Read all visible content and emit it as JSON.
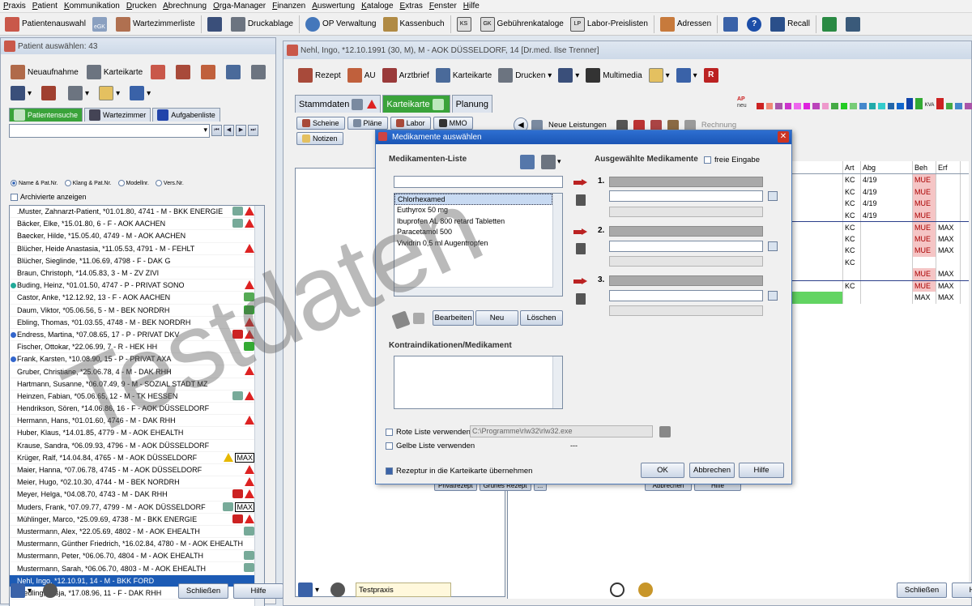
{
  "menu": [
    "Praxis",
    "Patient",
    "Kommunikation",
    "Drucken",
    "Abrechnung",
    "Orga-Manager",
    "Finanzen",
    "Auswertung",
    "Kataloge",
    "Extras",
    "Fenster",
    "Hilfe"
  ],
  "toolbar": {
    "patientenauswahl": "Patientenauswahl",
    "egk": "eGK",
    "wartezimmerliste": "Wartezimmerliste",
    "druckablage": "Druckablage",
    "op_verwaltung": "OP Verwaltung",
    "kassenbuch": "Kassenbuch",
    "ks": "KS",
    "gk": "GK",
    "gebuehrenkataloge": "Gebührenkataloge",
    "lp": "LP",
    "laborpreislisten": "Labor-Preislisten",
    "adressen": "Adressen",
    "recall": "Recall"
  },
  "left_window": {
    "title": "Patient auswählen: 43",
    "neuaufnahme": "Neuaufnahme",
    "karteikarte": "Karteikarte",
    "tabs": [
      "Patientensuche",
      "Wartezimmer",
      "Aufgabenliste"
    ],
    "radios": [
      "Name & Pat.Nr.",
      "Klang & Pat.Nr.",
      "Modellnr.",
      "Vers.Nr."
    ],
    "archiv": "Archivierte anzeigen",
    "patients": [
      {
        "text": ".Muster, Zahnarzt-Patient, *01.01.80, 4741 - M - BKK ENERGIE",
        "warn": "red",
        "mico": "#7a9",
        "max": ""
      },
      {
        "text": "Bäcker, Elke, *15.01.80, 6 - F - AOK AACHEN",
        "warn": "red",
        "mico": "#7a9",
        "max": ""
      },
      {
        "text": "Baecker, Hilde, *15.05.40, 4749 - M - AOK AACHEN",
        "warn": "",
        "mico": "",
        "max": ""
      },
      {
        "text": "Blücher, Heide Anastasia, *11.05.53, 4791 - M - FEHLT",
        "warn": "red",
        "mico": "",
        "max": ""
      },
      {
        "text": "Blücher, Sieglinde, *11.06.69, 4798 - F - DAK G",
        "warn": "",
        "mico": "",
        "max": ""
      },
      {
        "text": "Braun, Christoph, *14.05.83, 3 - M - ZV ZIVI",
        "warn": "",
        "mico": "",
        "max": ""
      },
      {
        "text": "Buding, Heinz, *01.01.50, 4747 - P - PRIVAT SONO",
        "warn": "red",
        "mico": "",
        "max": "",
        "dot": "#2a9"
      },
      {
        "text": "Castor, Anke, *12.12.92, 13 - F - AOK AACHEN",
        "warn": "",
        "mico": "#5a5",
        "max": ""
      },
      {
        "text": "Daum, Viktor, *05.06.56, 5 - M - BEK NORDRH",
        "warn": "",
        "mico": "#3a3",
        "max": ""
      },
      {
        "text": "Ebling, Thomas, *01.03.55, 4748 - M - BEK NORDRH",
        "warn": "red",
        "mico": "",
        "max": ""
      },
      {
        "text": "Endress, Martina, *07.08.65, 17 - P - PRIVAT DKV",
        "warn": "red",
        "mico": "#c22",
        "max": "",
        "dot": "#36c"
      },
      {
        "text": "Fischer, Ottokar, *22.06.99, 7 - R - HEK HH",
        "warn": "",
        "mico": "#3a3",
        "max": ""
      },
      {
        "text": "Frank, Karsten, *10.08.90, 15 - P - PRIVAT AXA",
        "warn": "",
        "mico": "",
        "max": "",
        "dot": "#36c"
      },
      {
        "text": "Gruber, Christiane, *25.06.78, 4 - M - DAK RHH",
        "warn": "red",
        "mico": "",
        "max": ""
      },
      {
        "text": "Hartmann, Susanne, *06.07.49, 9 - M - SOZIAL STADT MZ",
        "warn": "",
        "mico": "",
        "max": ""
      },
      {
        "text": "Heinzen, Fabian, *05.06.65, 12 - M - TK HESSEN",
        "warn": "red",
        "mico": "#7a9",
        "max": ""
      },
      {
        "text": "Hendrikson, Sören, *14.06.86, 16 - F - AOK DÜSSELDORF",
        "warn": "",
        "mico": "",
        "max": ""
      },
      {
        "text": "Hermann, Hans, *01.01.60, 4746 - M - DAK RHH",
        "warn": "red",
        "mico": "",
        "max": ""
      },
      {
        "text": "Huber, Klaus, *14.01.85, 4779 - M - AOK EHEALTH",
        "warn": "",
        "mico": "",
        "max": ""
      },
      {
        "text": "Krause, Sandra, *06.09.93, 4796 - M - AOK DÜSSELDORF",
        "warn": "",
        "mico": "",
        "max": ""
      },
      {
        "text": "Krüger, Ralf, *14.04.84, 4765 - M - AOK DÜSSELDORF",
        "warn": "yellow",
        "mico": "",
        "max": "MAX"
      },
      {
        "text": "Maier, Hanna, *07.06.78, 4745 - M - AOK DÜSSELDORF",
        "warn": "red",
        "mico": "",
        "max": ""
      },
      {
        "text": "Meier, Hugo, *02.10.30, 4744 - M - BEK NORDRH",
        "warn": "red",
        "mico": "",
        "max": ""
      },
      {
        "text": "Meyer, Helga, *04.08.70, 4743 - M - DAK RHH",
        "warn": "red",
        "mico": "#c22",
        "max": ""
      },
      {
        "text": "Muders, Frank, *07.09.77, 4799 - M - AOK DÜSSELDORF",
        "warn": "",
        "mico": "#7a9",
        "max": "MAX"
      },
      {
        "text": "Mühlinger, Marco, *25.09.69, 4738 - M - BKK ENERGIE",
        "warn": "red",
        "mico": "#c22",
        "max": ""
      },
      {
        "text": "Mustermann, Alex, *22.05.69, 4802 - M - AOK EHEALTH",
        "warn": "",
        "mico": "#7a9",
        "max": ""
      },
      {
        "text": "Mustermann, Günther Friedrich, *16.02.84, 4780 - M - AOK EHEALTH",
        "warn": "",
        "mico": "",
        "max": ""
      },
      {
        "text": "Mustermann, Peter, *06.06.70, 4804 - M - AOK EHEALTH",
        "warn": "",
        "mico": "#7a9",
        "max": ""
      },
      {
        "text": "Mustermann, Sarah, *06.06.70, 4803 - M - AOK EHEALTH",
        "warn": "",
        "mico": "#7a9",
        "max": ""
      },
      {
        "text": "Nehl, Ingo, *12.10.91, 14 - M - BKK FORD",
        "warn": "",
        "mico": "",
        "max": "",
        "sel": true
      },
      {
        "text": "Riedling, Tasja, *17.08.96, 11 - F - DAK RHH",
        "warn": "",
        "mico": "",
        "max": "",
        "dot": "#3a3"
      }
    ],
    "schliessen": "Schließen",
    "hilfe": "Hilfe"
  },
  "right_window": {
    "title": "Nehl, Ingo, *12.10.1991 (30, M), M - AOK DÜSSELDORF, 14 [Dr.med. Ilse Trenner]",
    "tools": [
      "Rezept",
      "AU",
      "Arztbrief",
      "Karteikarte",
      "Drucken",
      "Multimedia"
    ],
    "tabs": [
      "Stammdaten",
      "Karteikarte",
      "Planung"
    ],
    "subtabs": [
      "Scheine",
      "Pläne",
      "Labor",
      "MMO",
      "Notizen"
    ],
    "neue_leistungen": "Neue Leistungen",
    "rechnung": "Rechnung",
    "ap": "AP",
    "neu": "neu",
    "kva": "KVA",
    "columns": [
      "Art",
      "Abg",
      "Beh",
      "Erf"
    ],
    "rows": [
      {
        "art": "KC",
        "abg": "4/19",
        "beh": "MUE",
        "erf": ""
      },
      {
        "art": "KC",
        "abg": "4/19",
        "beh": "MUE",
        "erf": ""
      },
      {
        "art": "KC",
        "abg": "4/19",
        "beh": "MUE",
        "erf": ""
      },
      {
        "art": "KC",
        "abg": "4/19",
        "beh": "MUE",
        "erf": ""
      },
      {
        "art": "KC",
        "abg": "",
        "beh": "MUE",
        "erf": "MAX"
      },
      {
        "art": "KC",
        "abg": "",
        "beh": "MUE",
        "erf": "MAX"
      },
      {
        "art": "KC",
        "abg": "",
        "beh": "MUE",
        "erf": "MAX"
      },
      {
        "art": "KC",
        "abg": "",
        "beh": "",
        "erf": ""
      },
      {
        "art": "",
        "abg": "",
        "beh": "MUE",
        "erf": "MAX"
      },
      {
        "art": "KC",
        "abg": "",
        "beh": "MUE",
        "erf": "MAX"
      },
      {
        "art": "",
        "abg": "",
        "beh": "MAX",
        "erf": "MAX"
      }
    ],
    "praxis": "Testpraxis",
    "bg_buttons": [
      "Privatrezept",
      "Grünes Rezept",
      "..."
    ],
    "bg_buttons2": [
      "Abbrechen",
      "Hilfe"
    ],
    "schliessen": "Schließen",
    "hilfe": "Hilfe"
  },
  "dialog": {
    "title": "Medikamente auswählen",
    "list_label": "Medikamenten-Liste",
    "selected_label": "Ausgewählte Medikamente",
    "freie_eingabe": "freie Eingabe",
    "medications": [
      "Chlorhexamed",
      "Euthyrox 50 mg",
      "Ibuprofen AL 800 retard Tabletten",
      "Paracetamol 500",
      "Vividrin 0,5 ml Augentropfen"
    ],
    "slots": [
      "1.",
      "2.",
      "3."
    ],
    "bearbeiten": "Bearbeiten",
    "neu": "Neu",
    "loeschen": "Löschen",
    "kontra_label": "Kontraindikationen/Medikament",
    "rote_liste": "Rote Liste verwenden",
    "rote_liste_path": "C:\\Programme\\rlw32\\rlw32.exe",
    "gelbe_liste": "Gelbe Liste verwenden",
    "gelbe_liste_value": "---",
    "rezeptur": "Rezeptur in die Karteikarte übernehmen",
    "ok": "OK",
    "abbrechen": "Abbrechen",
    "hilfe": "Hilfe"
  },
  "watermark": "Testdaten"
}
